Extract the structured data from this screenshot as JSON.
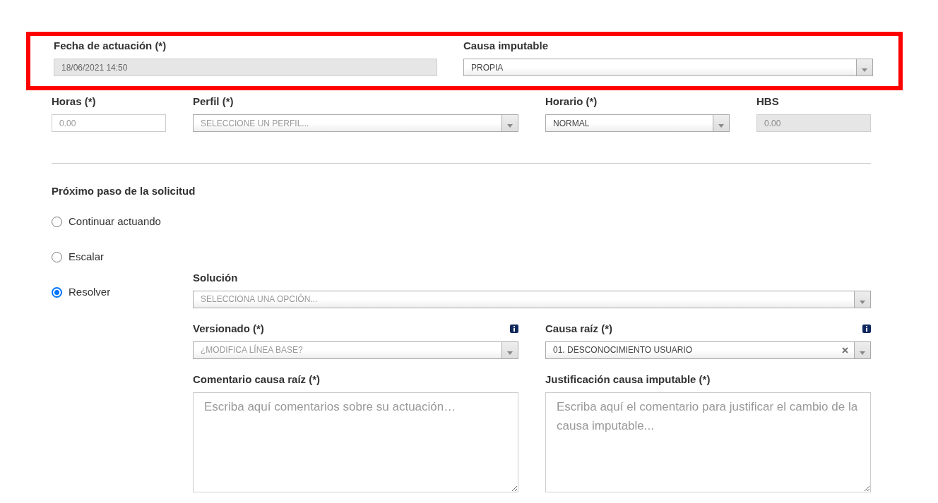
{
  "rows": [
    {
      "highlighted": true,
      "fields": [
        {
          "kind": "input",
          "label": "Fecha de actuación (*)",
          "value": "18/06/2021 14:50",
          "disabled": true
        },
        {
          "kind": "select",
          "label": "Causa imputable",
          "value": "PROPIA"
        }
      ]
    },
    {
      "highlighted": false,
      "fields": [
        {
          "kind": "input",
          "label": "Horas (*)",
          "placeholder": "0.00",
          "disabled": false
        },
        {
          "kind": "select",
          "label": "Perfil (*)",
          "placeholder": "SELECCIONE UN PERFIL..."
        },
        {
          "kind": "select",
          "label": "Horario (*)",
          "value": "NORMAL"
        },
        {
          "kind": "input",
          "label": "HBS",
          "placeholder": "0.00",
          "disabled": true
        }
      ]
    }
  ],
  "next_step": {
    "title": "Próximo paso de la solicitud",
    "options": [
      {
        "label": "Continuar actuando",
        "selected": false
      },
      {
        "label": "Escalar",
        "selected": false
      },
      {
        "label": "Resolver",
        "selected": true
      }
    ]
  },
  "solution": {
    "kind": "select",
    "label": "Solución",
    "placeholder": "SELECCIONA UNA OPCIÓN..."
  },
  "resolution_fields": [
    {
      "kind": "select",
      "label": "Versionado (*)",
      "placeholder": "¿MODIFICA LÍNEA BASE?",
      "info": true
    },
    {
      "kind": "select",
      "label": "Causa raíz (*)",
      "value": "01. DESCONOCIMIENTO USUARIO",
      "info": true,
      "clearable": true
    },
    {
      "kind": "textarea",
      "label": "Comentario causa raíz (*)",
      "placeholder": "Escriba aquí comentarios sobre su actuación…"
    },
    {
      "kind": "textarea",
      "label": "Justificación causa imputable (*)",
      "placeholder": "Escriba aquí el comentario para justificar el cambio de la causa imputable..."
    }
  ]
}
